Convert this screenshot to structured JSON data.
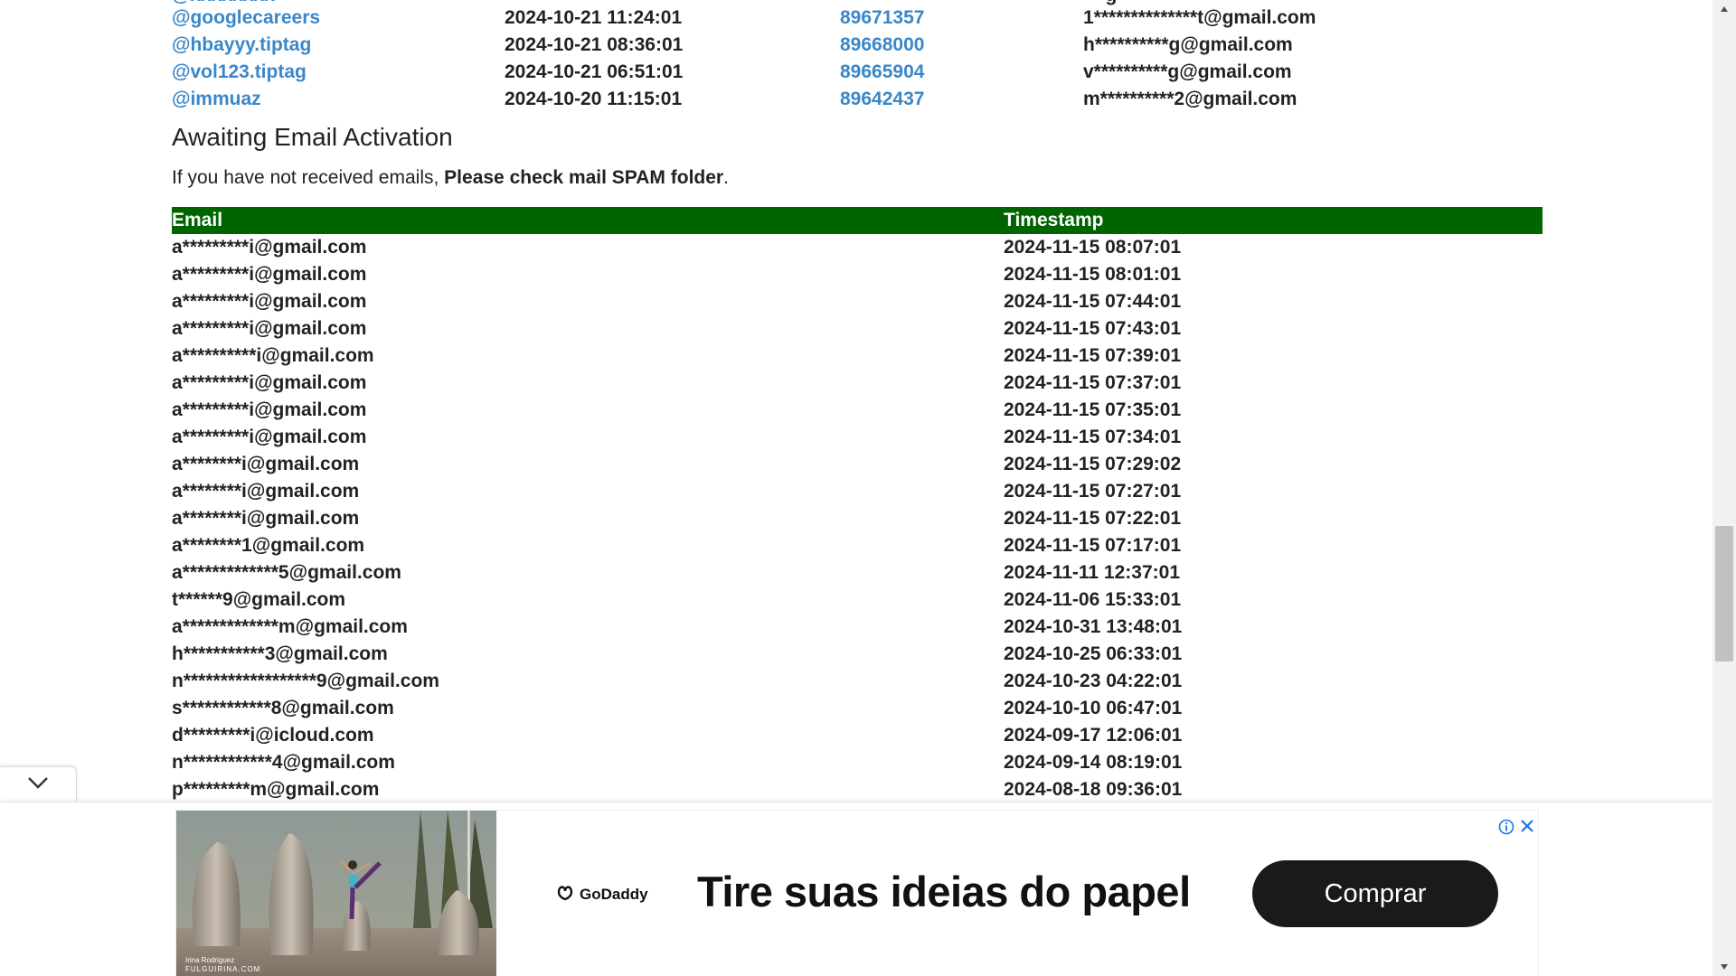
{
  "users": [
    {
      "handle": "@googlecareers",
      "timestamp": "2024-10-21 11:24:01",
      "id": "89671357",
      "email": "1**************t@gmail.com"
    },
    {
      "handle": "@hbayyy.tiptag",
      "timestamp": "2024-10-21 08:36:01",
      "id": "89668000",
      "email": "h**********g@gmail.com"
    },
    {
      "handle": "@vol123.tiptag",
      "timestamp": "2024-10-21 06:51:01",
      "id": "89665904",
      "email": "v**********g@gmail.com"
    },
    {
      "handle": "@immuaz",
      "timestamp": "2024-10-20 11:15:01",
      "id": "89642437",
      "email": "m**********2@gmail.com"
    }
  ],
  "awaiting": {
    "title": "Awaiting Email Activation",
    "note_prefix": "If you have not received emails, ",
    "note_bold": "Please check mail SPAM folder",
    "note_suffix": ".",
    "headers": {
      "email": "Email",
      "timestamp": "Timestamp"
    },
    "rows": [
      {
        "email": "a*********i@gmail.com",
        "timestamp": "2024-11-15 08:07:01"
      },
      {
        "email": "a*********i@gmail.com",
        "timestamp": "2024-11-15 08:01:01"
      },
      {
        "email": "a*********i@gmail.com",
        "timestamp": "2024-11-15 07:44:01"
      },
      {
        "email": "a*********i@gmail.com",
        "timestamp": "2024-11-15 07:43:01"
      },
      {
        "email": "a**********i@gmail.com",
        "timestamp": "2024-11-15 07:39:01"
      },
      {
        "email": "a*********i@gmail.com",
        "timestamp": "2024-11-15 07:37:01"
      },
      {
        "email": "a*********i@gmail.com",
        "timestamp": "2024-11-15 07:35:01"
      },
      {
        "email": "a*********i@gmail.com",
        "timestamp": "2024-11-15 07:34:01"
      },
      {
        "email": "a********i@gmail.com",
        "timestamp": "2024-11-15 07:29:02"
      },
      {
        "email": "a********i@gmail.com",
        "timestamp": "2024-11-15 07:27:01"
      },
      {
        "email": "a********i@gmail.com",
        "timestamp": "2024-11-15 07:22:01"
      },
      {
        "email": "a********1@gmail.com",
        "timestamp": "2024-11-15 07:17:01"
      },
      {
        "email": "a*************5@gmail.com",
        "timestamp": "2024-11-11 12:37:01"
      },
      {
        "email": "t******9@gmail.com",
        "timestamp": "2024-11-06 15:33:01"
      },
      {
        "email": "a*************m@gmail.com",
        "timestamp": "2024-10-31 13:48:01"
      },
      {
        "email": "h***********3@gmail.com",
        "timestamp": "2024-10-25 06:33:01"
      },
      {
        "email": "n******************9@gmail.com",
        "timestamp": "2024-10-23 04:22:01"
      },
      {
        "email": "s************8@gmail.com",
        "timestamp": "2024-10-10 06:47:01"
      },
      {
        "email": "d*********i@icloud.com",
        "timestamp": "2024-09-17 12:06:01"
      },
      {
        "email": "n************4@gmail.com",
        "timestamp": "2024-09-14 08:19:01"
      },
      {
        "email": "p*********m@gmail.com",
        "timestamp": "2024-08-18 09:36:01"
      }
    ]
  },
  "ad": {
    "logo_text": "GoDaddy",
    "headline": "Tire suas ideias do papel",
    "cta_label": "Comprar",
    "photo_credit_line1": "Irina Rodriguez",
    "photo_credit_line2": "FULGUIRINA.COM",
    "info_icon": "info-icon",
    "close_icon": "close-icon"
  },
  "icons": {
    "collapse": "chevron-down-icon",
    "scroll_up": "scroll-up-arrow-icon",
    "scroll_down": "scroll-down-arrow-icon"
  },
  "colors": {
    "link": "#3a87c9",
    "table_header_bg": "#006400",
    "text": "#222222",
    "cta_bg": "#1a1a1a",
    "ad_info": "#1a73e8"
  }
}
